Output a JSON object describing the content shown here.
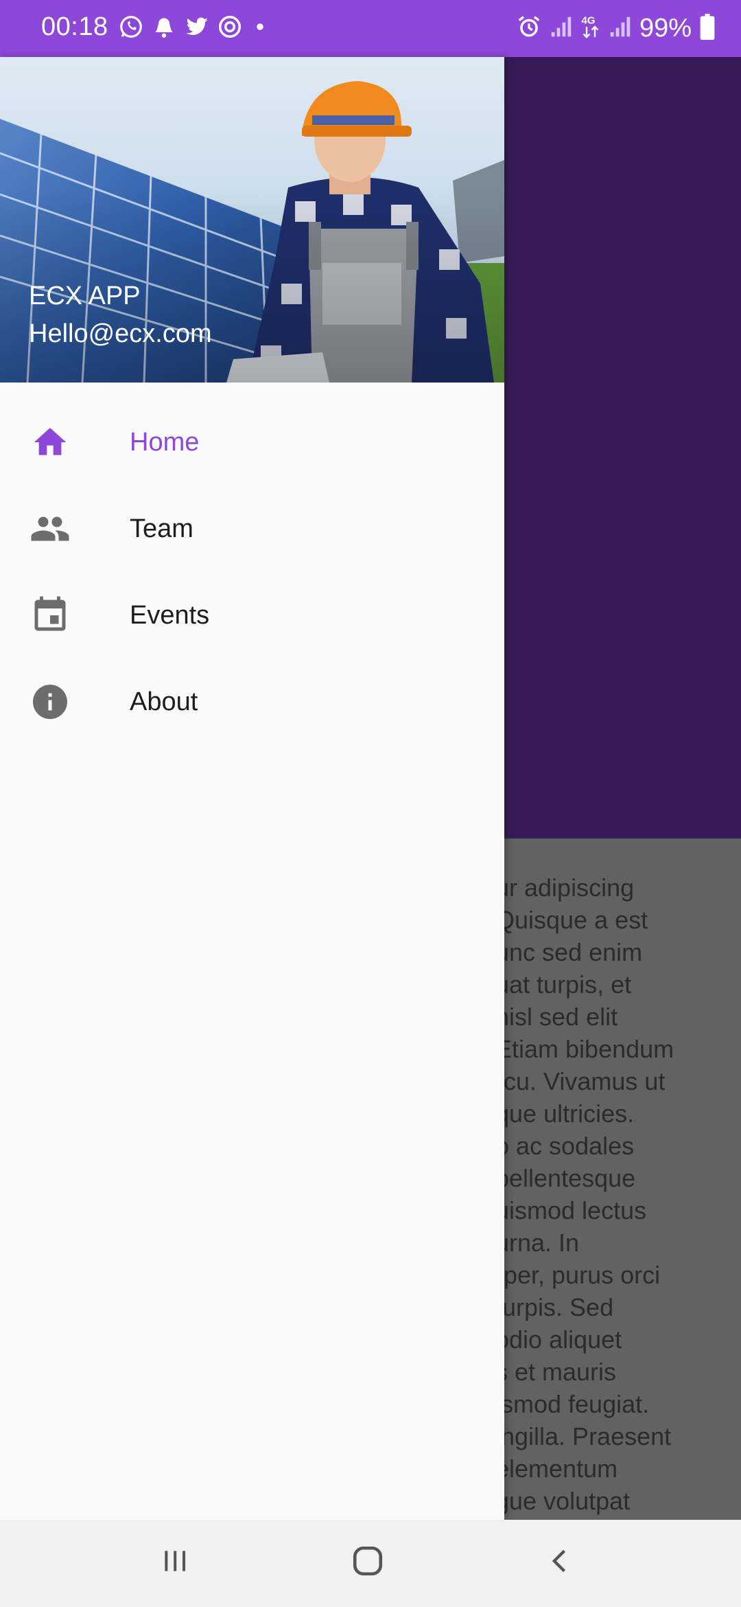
{
  "status_bar": {
    "time": "00:18",
    "battery": "99%",
    "notification_icons": [
      "whatsapp-icon",
      "notification-bell-icon",
      "twitter-icon",
      "sync-icon",
      "more-dot-icon"
    ],
    "system_icons": [
      "alarm-icon",
      "signal-icon",
      "4g-data-icon",
      "signal-icon",
      "battery-icon"
    ]
  },
  "drawer": {
    "header": {
      "app_name": "ECX APP",
      "email": "Hello@ecx.com"
    },
    "items": [
      {
        "label": "Home",
        "icon": "home-icon",
        "active": true
      },
      {
        "label": "Team",
        "icon": "people-icon",
        "active": false
      },
      {
        "label": "Events",
        "icon": "calendar-icon",
        "active": false
      },
      {
        "label": "About",
        "icon": "info-icon",
        "active": false
      }
    ]
  },
  "background_content": {
    "lines": [
      "ur adipiscing",
      "Quisque a est",
      "unc sed enim",
      "uat turpis, et",
      "nisl sed elit",
      "Etiam bibendum",
      "rcu. Vivamus ut",
      "que ultricies.",
      "o ac sodales",
      "pellentesque",
      "uismod lectus",
      "urna. In",
      "rper, purus orci",
      "turpis. Sed",
      "odio aliquet",
      "s et mauris",
      "ismod feugiat.",
      "ingilla. Praesent",
      "elementum",
      "gue volutpat"
    ]
  },
  "colors": {
    "accent": "#8d47d9",
    "status_bar": "#8d47d9",
    "background_header": "#371b58",
    "drawer_bg": "#fafafa",
    "icon_gray": "#6d6d6d"
  },
  "nav_bar": {
    "buttons": [
      "recent-apps-icon",
      "home-circle-icon",
      "back-icon"
    ]
  }
}
